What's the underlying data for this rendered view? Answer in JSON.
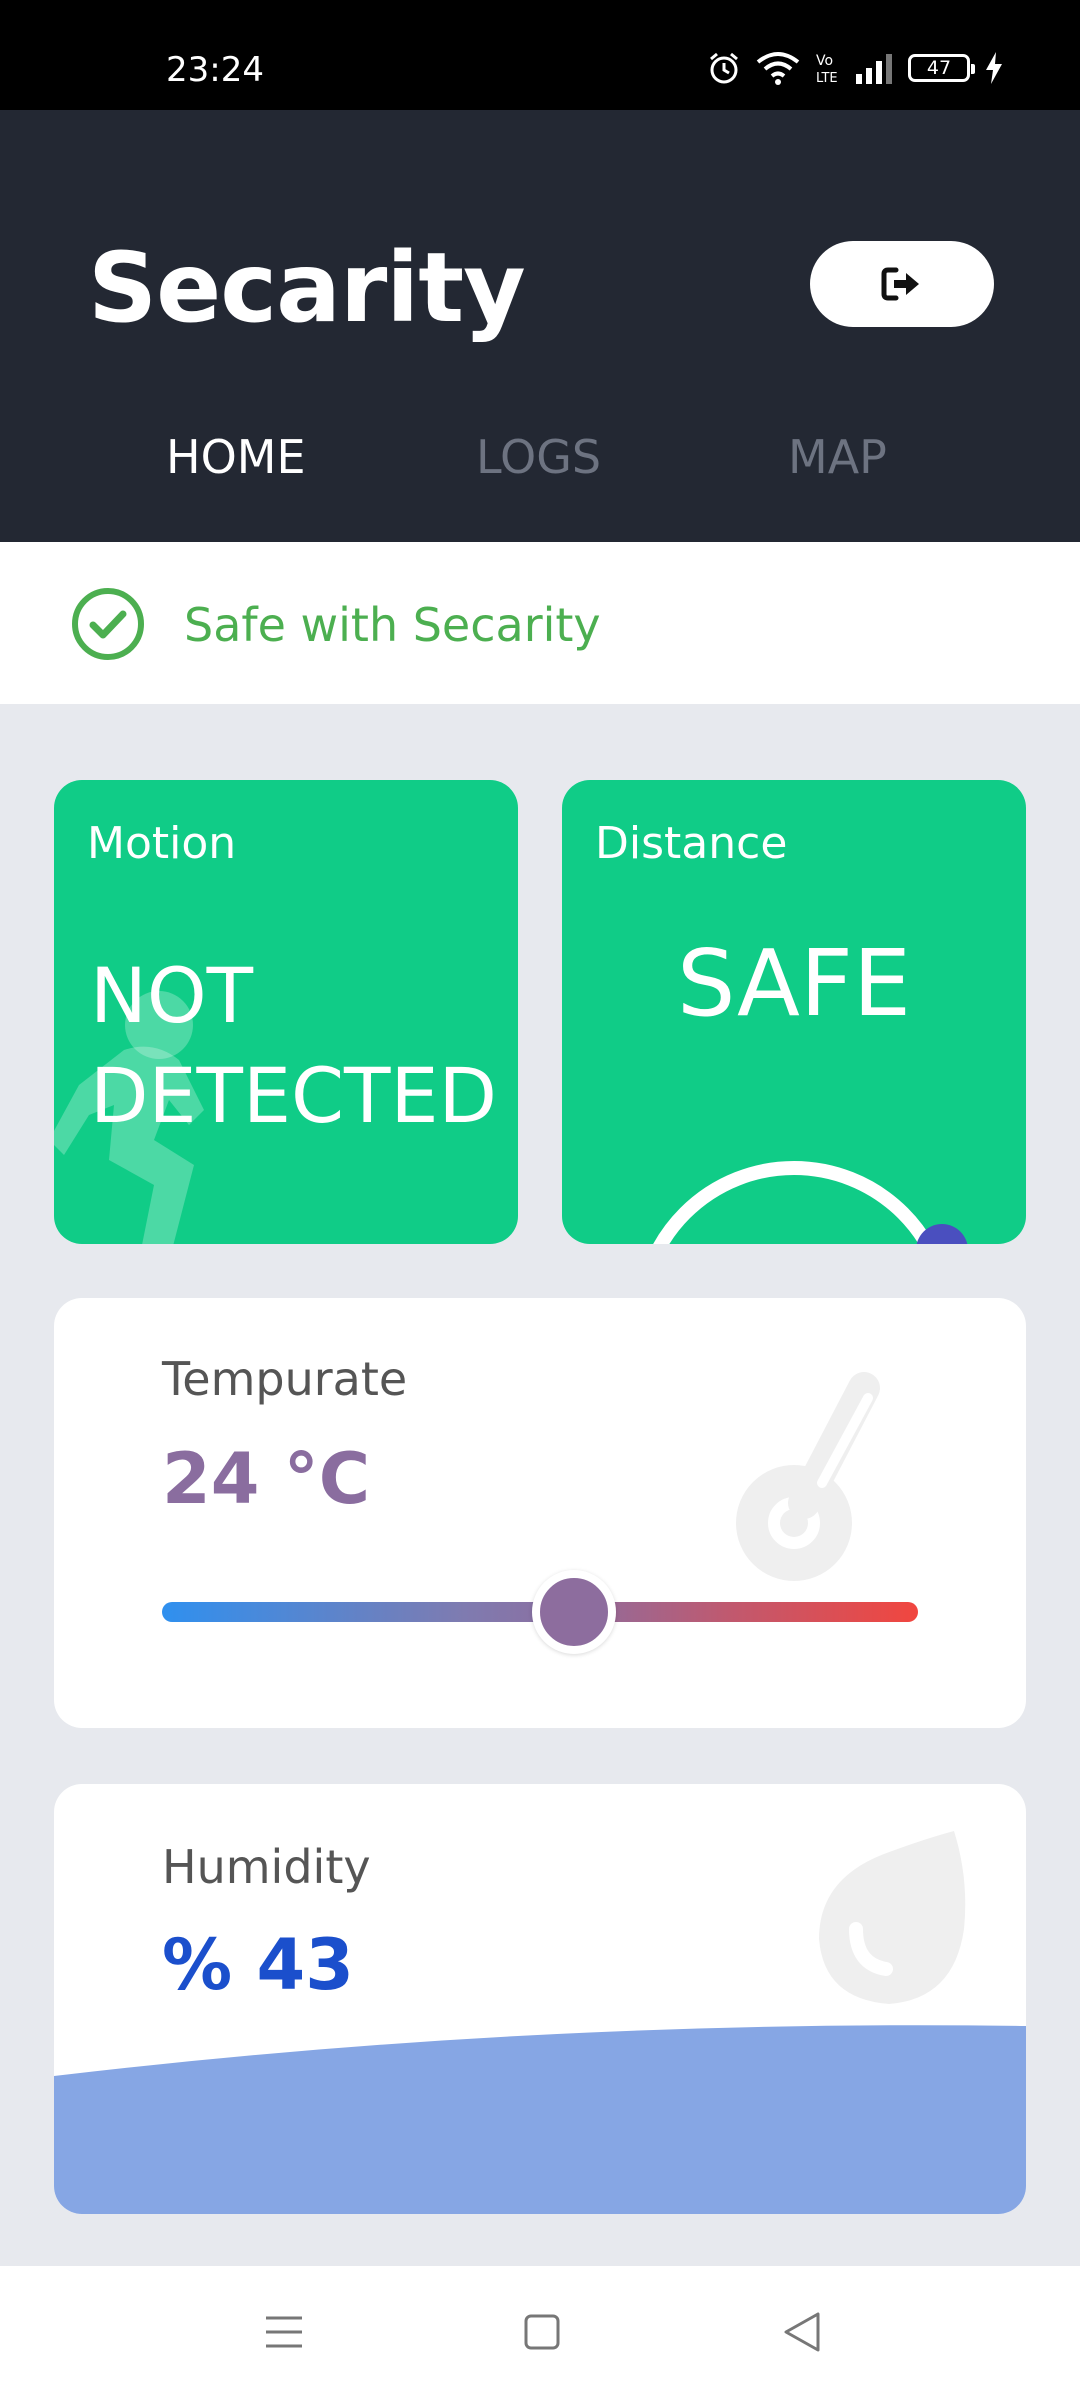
{
  "status_bar": {
    "time": "23:24",
    "battery": "47",
    "icons": [
      "alarm-icon",
      "wifi-icon",
      "volte-icon",
      "signal-icon",
      "battery-icon",
      "charging-icon"
    ]
  },
  "header": {
    "title": "Secarity",
    "logout_icon": "logout-icon",
    "tabs": [
      {
        "label": "HOME",
        "active": true
      },
      {
        "label": "LOGS",
        "active": false
      },
      {
        "label": "MAP",
        "active": false
      }
    ]
  },
  "banner": {
    "icon": "check-circle-icon",
    "text": "Safe with Secarity",
    "color": "#4caf50"
  },
  "motion_card": {
    "label": "Motion",
    "value": "NOT DETECTED",
    "icon": "running-person-icon",
    "color": "#10cc87"
  },
  "distance_card": {
    "label": "Distance",
    "value": "SAFE",
    "color": "#10cc87"
  },
  "temperature_card": {
    "label": "Tempurate",
    "value": "24 °C",
    "slider_fraction": 0.545,
    "icon": "thermometer-icon",
    "color": "#8a6d9f"
  },
  "humidity_card": {
    "label": "Humidity",
    "value": "% 43",
    "fill_fraction": 0.43,
    "icon": "water-drop-icon",
    "color": "#1b4fcc",
    "wave_color": "#86a6e4"
  },
  "nav_bar": {
    "buttons": [
      "menu-icon",
      "home-square-icon",
      "back-triangle-icon"
    ]
  }
}
